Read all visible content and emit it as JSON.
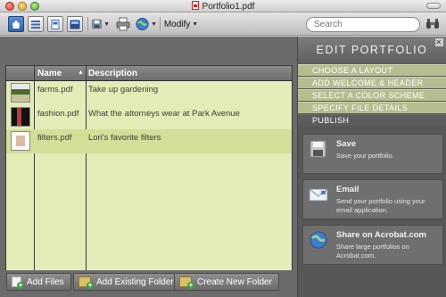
{
  "window": {
    "title": "Portfolio1.pdf"
  },
  "toolbar": {
    "modify_label": "Modify",
    "search_placeholder": "Search",
    "view_buttons": [
      "home-icon",
      "detail-view-icon",
      "page-view-icon",
      "layout-view-icon"
    ],
    "icons": [
      "save-icon",
      "print-icon",
      "share-globe-icon",
      "binoculars-icon"
    ]
  },
  "table": {
    "columns": {
      "name": "Name",
      "description": "Description"
    },
    "rows": [
      {
        "name": "farms.pdf",
        "description": "Take up gardening"
      },
      {
        "name": "fashion.pdf",
        "description": "What the attorneys wear at Park Avenue"
      },
      {
        "name": "filters.pdf",
        "description": "Lori's favorite filters"
      }
    ],
    "selected_row": 2
  },
  "bottom_buttons": {
    "add_files": "Add Files",
    "add_existing_folder": "Add Existing Folder",
    "create_new_folder": "Create New Folder"
  },
  "edit_panel": {
    "title": "EDIT PORTFOLIO",
    "menu": [
      {
        "label": "CHOOSE A LAYOUT"
      },
      {
        "label": "ADD WELCOME & HEADER"
      },
      {
        "label": "SELECT A COLOR SCHEME"
      },
      {
        "label": "SPECIFY FILE DETAILS"
      },
      {
        "label": "PUBLISH"
      }
    ],
    "active_menu": "PUBLISH",
    "cards": [
      {
        "title": "Save",
        "desc": "Save your portfolio.",
        "icon": "floppy-disk-icon"
      },
      {
        "title": "Email",
        "desc": "Send your portfolio using your email application.",
        "icon": "envelope-icon"
      },
      {
        "title": "Share on Acrobat.com",
        "desc": "Share large portfolios on Acrobat.com.",
        "icon": "globe-icon"
      }
    ]
  },
  "colors": {
    "table_bg": "#e3ebb6",
    "selected_row_bg": "#d4de98",
    "menu_bg": "#b7bc90",
    "panel_bg": "#575757"
  }
}
